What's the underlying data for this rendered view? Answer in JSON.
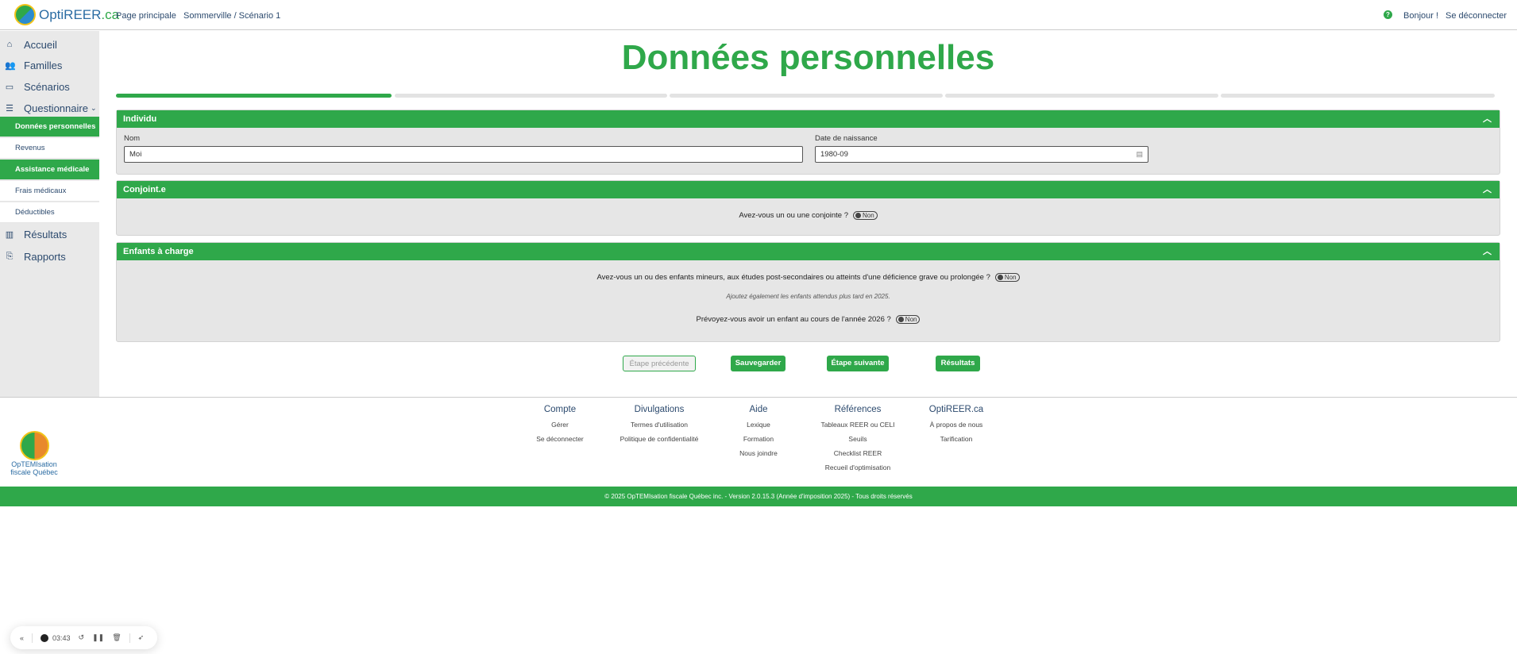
{
  "header": {
    "brand": "OptiREER",
    "brand_suffix": ".ca",
    "nav": [
      "Page principale",
      "Sommerville / Scénario 1"
    ],
    "greeting": "Bonjour !",
    "logout": "Se déconnecter"
  },
  "sidebar": {
    "items": [
      {
        "label": "Accueil",
        "icon": "home-icon"
      },
      {
        "label": "Familles",
        "icon": "family-icon"
      },
      {
        "label": "Scénarios",
        "icon": "scenario-icon"
      },
      {
        "label": "Questionnaire",
        "icon": "document-icon"
      }
    ],
    "sub_items": [
      "Données personnelles",
      "Revenus",
      "Assistance médicale",
      "Frais médicaux",
      "Déductibles"
    ],
    "bottom_items": [
      {
        "label": "Résultats",
        "icon": "chart-icon"
      },
      {
        "label": "Rapports",
        "icon": "report-icon"
      }
    ]
  },
  "page": {
    "title": "Données personnelles",
    "progress_step": 1,
    "progress_total": 5
  },
  "individu": {
    "title": "Individu",
    "nom_label": "Nom",
    "nom_value": "Moi",
    "date_label": "Date de naissance",
    "date_value": "1980-09"
  },
  "conjoint": {
    "title": "Conjoint.e",
    "question": "Avez-vous un ou une conjointe ?",
    "toggle": "Non"
  },
  "enfants": {
    "title": "Enfants à charge",
    "question1": "Avez-vous un ou des enfants mineurs, aux études post-secondaires ou atteints d'une déficience grave ou prolongée ?",
    "toggle1": "Non",
    "note": "Ajoutez également les enfants attendus plus tard en 2025.",
    "question2": "Prévoyez-vous avoir un enfant au cours de l'année 2026 ?",
    "toggle2": "Non"
  },
  "buttons": {
    "prev": "Étape précédente",
    "save": "Sauvegarder",
    "next": "Étape suivante",
    "results": "Résultats"
  },
  "footer": {
    "logo": "OpTEMIsation fiscale Québec",
    "columns": [
      {
        "title": "Compte",
        "links": [
          "Gérer",
          "Se déconnecter"
        ]
      },
      {
        "title": "Divulgations",
        "links": [
          "Termes d'utilisation",
          "Politique de confidentialité"
        ]
      },
      {
        "title": "Aide",
        "links": [
          "Lexique",
          "Formation",
          "Nous joindre"
        ]
      },
      {
        "title": "Références",
        "links": [
          "Tableaux REER ou CELI",
          "Seuils",
          "Checklist REER",
          "Recueil d'optimisation"
        ]
      },
      {
        "title": "OptiREER.ca",
        "links": [
          "À propos de nous",
          "Tarification"
        ]
      }
    ],
    "copyright": "© 2025 OpTEMIsation fiscale Québec inc. - Version 2.0.15.3 (Année d'imposition 2025) - Tous droits réservés"
  },
  "recorder": {
    "time": "03:43"
  },
  "colors": {
    "accent": "#2fa84a",
    "text": "#2c4a6e"
  }
}
